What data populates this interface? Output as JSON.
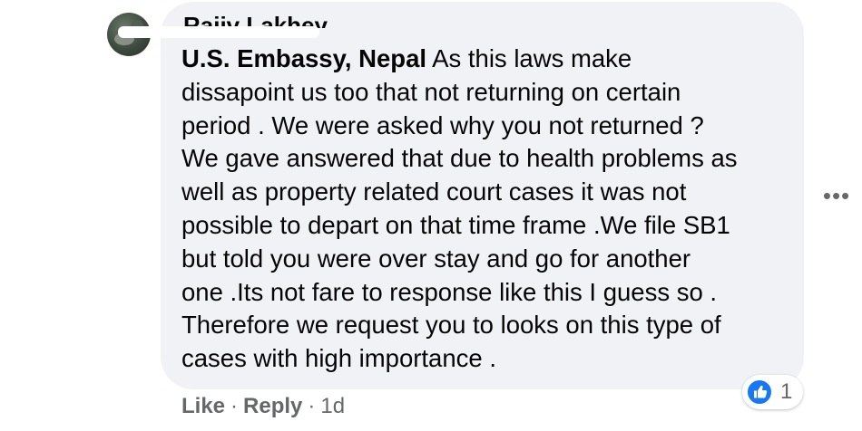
{
  "comment": {
    "author_name": "Rajiv Lakhey",
    "mention": "U.S. Embassy, Nepal",
    "body": " As this laws make\ndissapoint us too that not returning on certain\nperiod . We were asked why you not returned ?\nWe gave answered that due to health problems as\nwell as property related court cases it was not\npossible to depart on that time frame .We file SB1\nbut told you were over stay and go for another\none .Its not fare to response like this I guess so .\nTherefore we request you to looks on this type of\ncases with high importance ."
  },
  "actions": {
    "like_label": "Like",
    "separator": "·",
    "reply_label": "Reply",
    "timestamp": "1d"
  },
  "reactions": {
    "icon": "like-icon",
    "count": "1",
    "icon_color": "#1877f2"
  },
  "more_options": {
    "icon": "more-horizontal-icon",
    "glyph": "•••"
  },
  "colors": {
    "bubble_bg": "#f0f2f5",
    "text": "#050505",
    "secondary_text": "#65676b",
    "accent": "#1877f2"
  }
}
